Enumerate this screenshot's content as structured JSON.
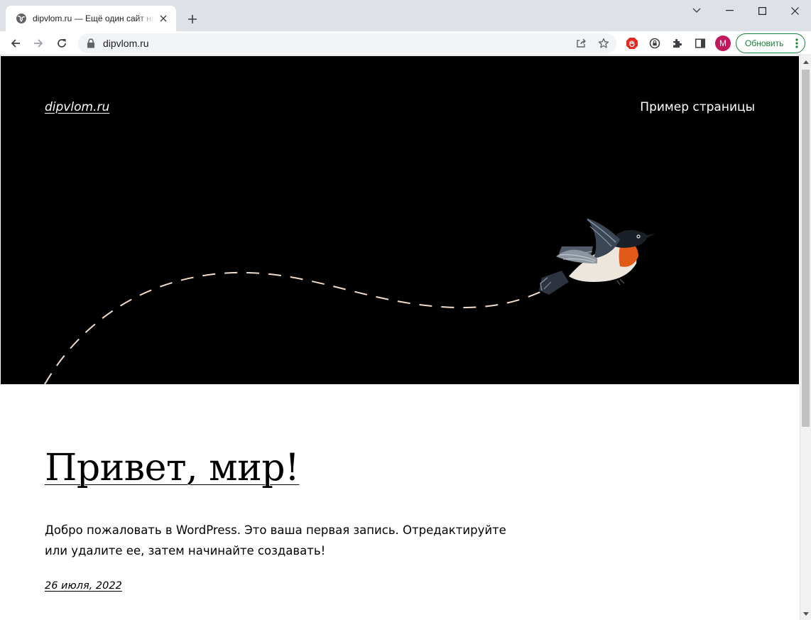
{
  "browser": {
    "tab_title": "dipvlom.ru — Ещё один сайт на WordPress",
    "url": "dipvlom.ru",
    "profile_initial": "M",
    "update_label": "Обновить",
    "accent_color": "#188038",
    "profile_color": "#c2185b"
  },
  "site": {
    "title": "dipvlom.ru",
    "nav_link": "Пример страницы"
  },
  "post": {
    "title": "Привет, мир!",
    "body": "Добро пожаловать в WordPress. Это ваша первая запись. Отредактируйте или удалите ее, затем начинайте создавать!",
    "date": "26 июля, 2022"
  },
  "icons": {
    "favicon": "globe-icon",
    "tab_close": "close-icon",
    "new_tab": "plus-icon",
    "back": "arrow-left-icon",
    "forward": "arrow-right-icon",
    "reload": "reload-icon",
    "lock": "lock-icon",
    "share": "share-icon",
    "bookmark": "star-icon",
    "extension_1": "adblock-icon",
    "extension_2": "extension-lock-icon",
    "extensions": "puzzle-icon",
    "side_panel": "side-panel-icon",
    "menu": "kebab-menu-icon"
  }
}
